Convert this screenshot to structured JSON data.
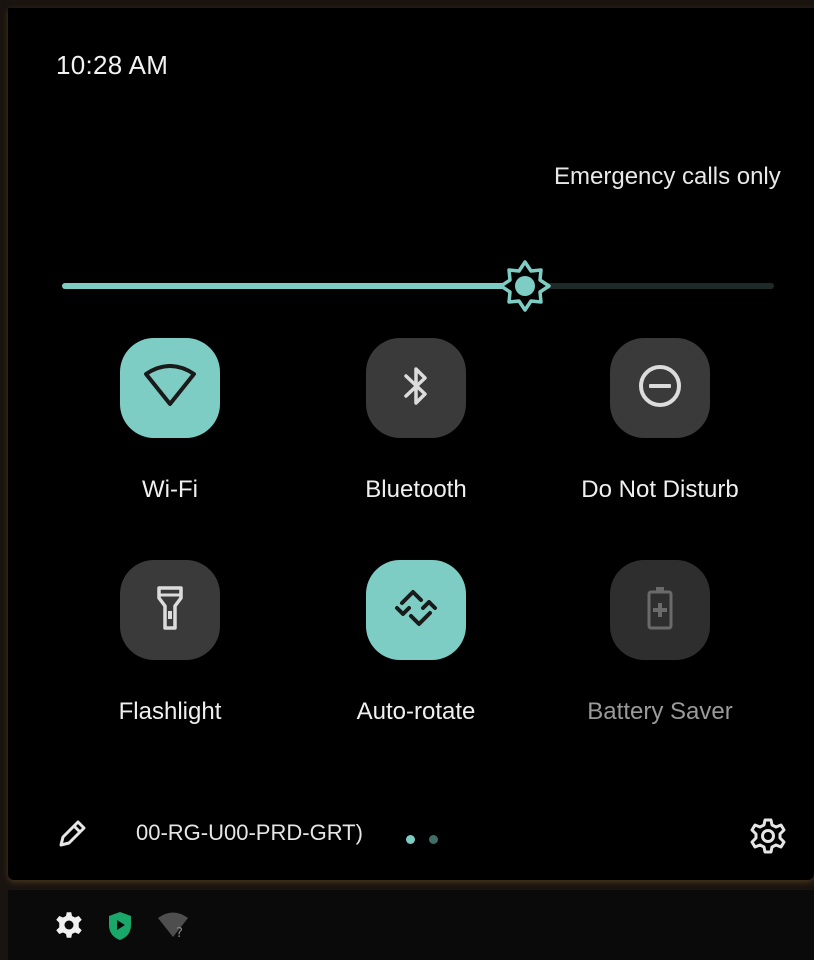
{
  "header": {
    "time": "10:28 AM",
    "carrier_status": "Emergency calls only"
  },
  "brightness": {
    "level": 0.65,
    "icon": "brightness-icon"
  },
  "tiles": [
    {
      "label": "Wi-Fi",
      "icon": "wifi-icon",
      "state": "on"
    },
    {
      "label": "Bluetooth",
      "icon": "bluetooth-icon",
      "state": "off"
    },
    {
      "label": "Do Not Disturb",
      "icon": "do-not-disturb-icon",
      "state": "off"
    },
    {
      "label": "Flashlight",
      "icon": "flashlight-icon",
      "state": "off"
    },
    {
      "label": "Auto-rotate",
      "icon": "auto-rotate-icon",
      "state": "on"
    },
    {
      "label": "Battery Saver",
      "icon": "battery-saver-icon",
      "state": "unavailable"
    }
  ],
  "footer": {
    "network_name": "00-RG-U00-PRD-GRT)",
    "page_count": 2,
    "current_page": 1
  },
  "status_bar": {
    "icons": [
      "settings-icon",
      "shield-play-icon",
      "wifi-unknown-icon"
    ]
  },
  "colors": {
    "accent": "#7ecdc4",
    "tile_off": "#3a3a3a",
    "background": "#000000",
    "shield_green": "#1aa86a"
  }
}
